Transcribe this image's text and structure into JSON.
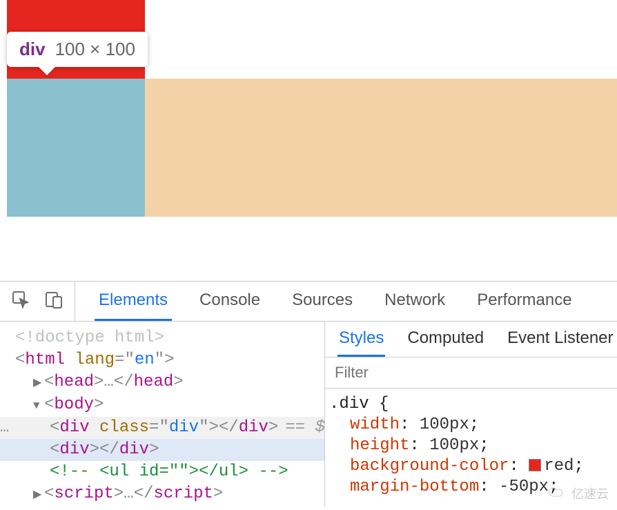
{
  "inspect_tooltip": {
    "tag": "div",
    "dimensions": "100 × 100"
  },
  "devtools": {
    "main_tabs": {
      "elements": "Elements",
      "console": "Console",
      "sources": "Sources",
      "network": "Network",
      "performance": "Performance"
    },
    "active_main_tab": "elements",
    "elements_tree": {
      "doctype": "<!doctype html>",
      "html_open": {
        "tag": "html",
        "attr": "lang",
        "value": "en"
      },
      "head": {
        "tag": "head",
        "ellipsis": "…"
      },
      "body_open": {
        "tag": "body"
      },
      "div1": {
        "tag": "div",
        "attr": "class",
        "value": "div",
        "match": "== $"
      },
      "div2": {
        "tag": "div"
      },
      "comment": "<!-- <ul id=\"\"></ul> -->",
      "script": {
        "tag": "script",
        "ellipsis": "…"
      }
    },
    "styles_panel": {
      "sub_tabs": {
        "styles": "Styles",
        "computed": "Computed",
        "event_listeners": "Event Listener"
      },
      "active_sub_tab": "styles",
      "filter_placeholder": "Filter",
      "rule": {
        "selector": ".div",
        "brace_open": "{",
        "props": {
          "width": {
            "name": "width",
            "value": "100px",
            "term": ";"
          },
          "height": {
            "name": "height",
            "value": "100px",
            "term": ";"
          },
          "bgcolor": {
            "name": "background-color",
            "value": "red",
            "term": ";",
            "swatch": "#e52620"
          },
          "marginbottom": {
            "name": "margin-bottom",
            "value": "-50px",
            "term": ";"
          }
        }
      }
    }
  },
  "watermark": "亿速云"
}
